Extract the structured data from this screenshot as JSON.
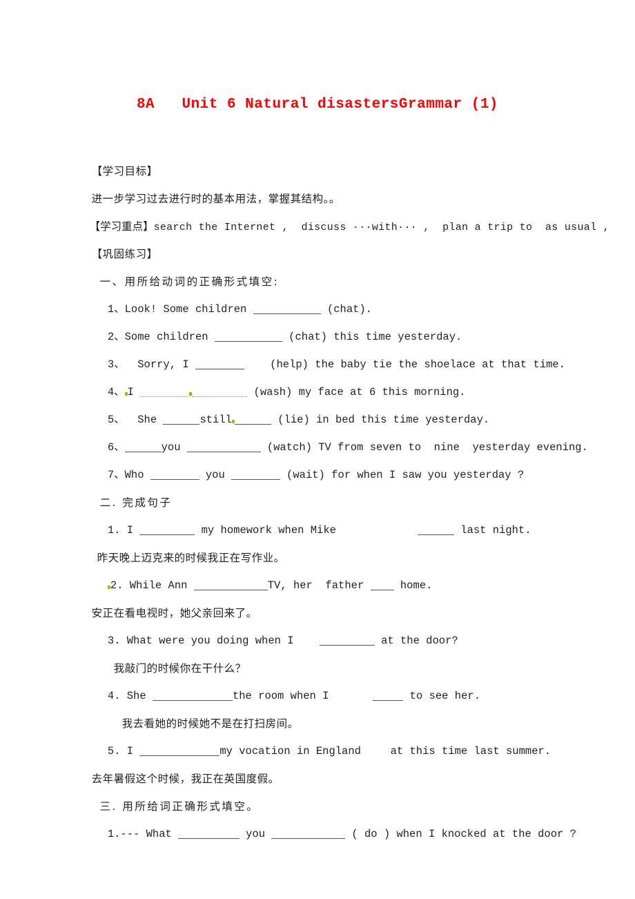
{
  "colors": {
    "title": "#ff0000",
    "body": "#222222",
    "blank_rule": "#555555",
    "grammar_mark": "#b5b300",
    "page_background": "#ffffff"
  },
  "document": {
    "title": "8A   Unit 6 Natural disastersGrammar (1)",
    "sections": {
      "objective_heading": "【学习目标】",
      "objective_text": "进一步学习过去进行时的基本用法，掌握其结构。。",
      "keypoint_heading": "【学习重点】",
      "keypoint_text": "search the Internet ,  discuss ···with··· ,  plan a trip to  as usual ,",
      "practice_heading": "【巩固练习】",
      "part_one_heading": "一、用所给动词的正确形式填空:",
      "part_two_heading": "二. 完成句子",
      "part_three_heading": "三. 用所给词正确形式填空。"
    },
    "part_one": [
      {
        "num": "1、",
        "pre": "Look! Some children ",
        "post": " (chat)."
      },
      {
        "num": "2、",
        "pre": "Some children ",
        "post": " (chat) this time yesterday."
      },
      {
        "num": "3、",
        "pre": "  Sorry, I ",
        "post": "    (help) the baby tie the shoelace at that time."
      },
      {
        "num": "4、",
        "pre": "I ",
        "post": " (wash) my face at 6 this morning."
      },
      {
        "num": "5、",
        "pre": "  She ",
        "mid": "still",
        "post": " (lie) in bed this time yesterday."
      },
      {
        "num": "6、",
        "pre": "",
        "mid": "you",
        "post": " (watch) TV from seven to  nine  yesterday evening."
      },
      {
        "num": "7、",
        "pre": "Who ",
        "mid": "you",
        "post": " (wait) for when I saw you yesterday ?"
      }
    ],
    "part_two": [
      {
        "num": "1. ",
        "pre": "I ",
        "mid": " my homework when Mike",
        "post": " last night.",
        "translation": "昨天晚上迈克来的时候我正在写作业。"
      },
      {
        "num": "2. ",
        "pre": "While Ann ",
        "mid": "TV, her  father ",
        "post": " home.",
        "translation": "安正在看电视时，她父亲回来了。"
      },
      {
        "num": "3. ",
        "pre": "What were you doing when I    ",
        "post": " at the door?",
        "translation": "我敲门的时候你在干什么？"
      },
      {
        "num": "4. ",
        "pre": "She ",
        "mid": "the room when I   ",
        "post": " to see her.",
        "translation": "我去看她的时候她不是在打扫房间。"
      },
      {
        "num": "5. ",
        "pre": "I ",
        "mid": "my vocation in England",
        "post": "  at this time last summer.",
        "translation": "去年暑假这个时候，我正在英国度假。"
      }
    ],
    "part_three": [
      {
        "num": "1.",
        "pre": "--- What ",
        "mid": "you",
        "post": " ( do ) when I knocked at the door ?"
      }
    ]
  }
}
